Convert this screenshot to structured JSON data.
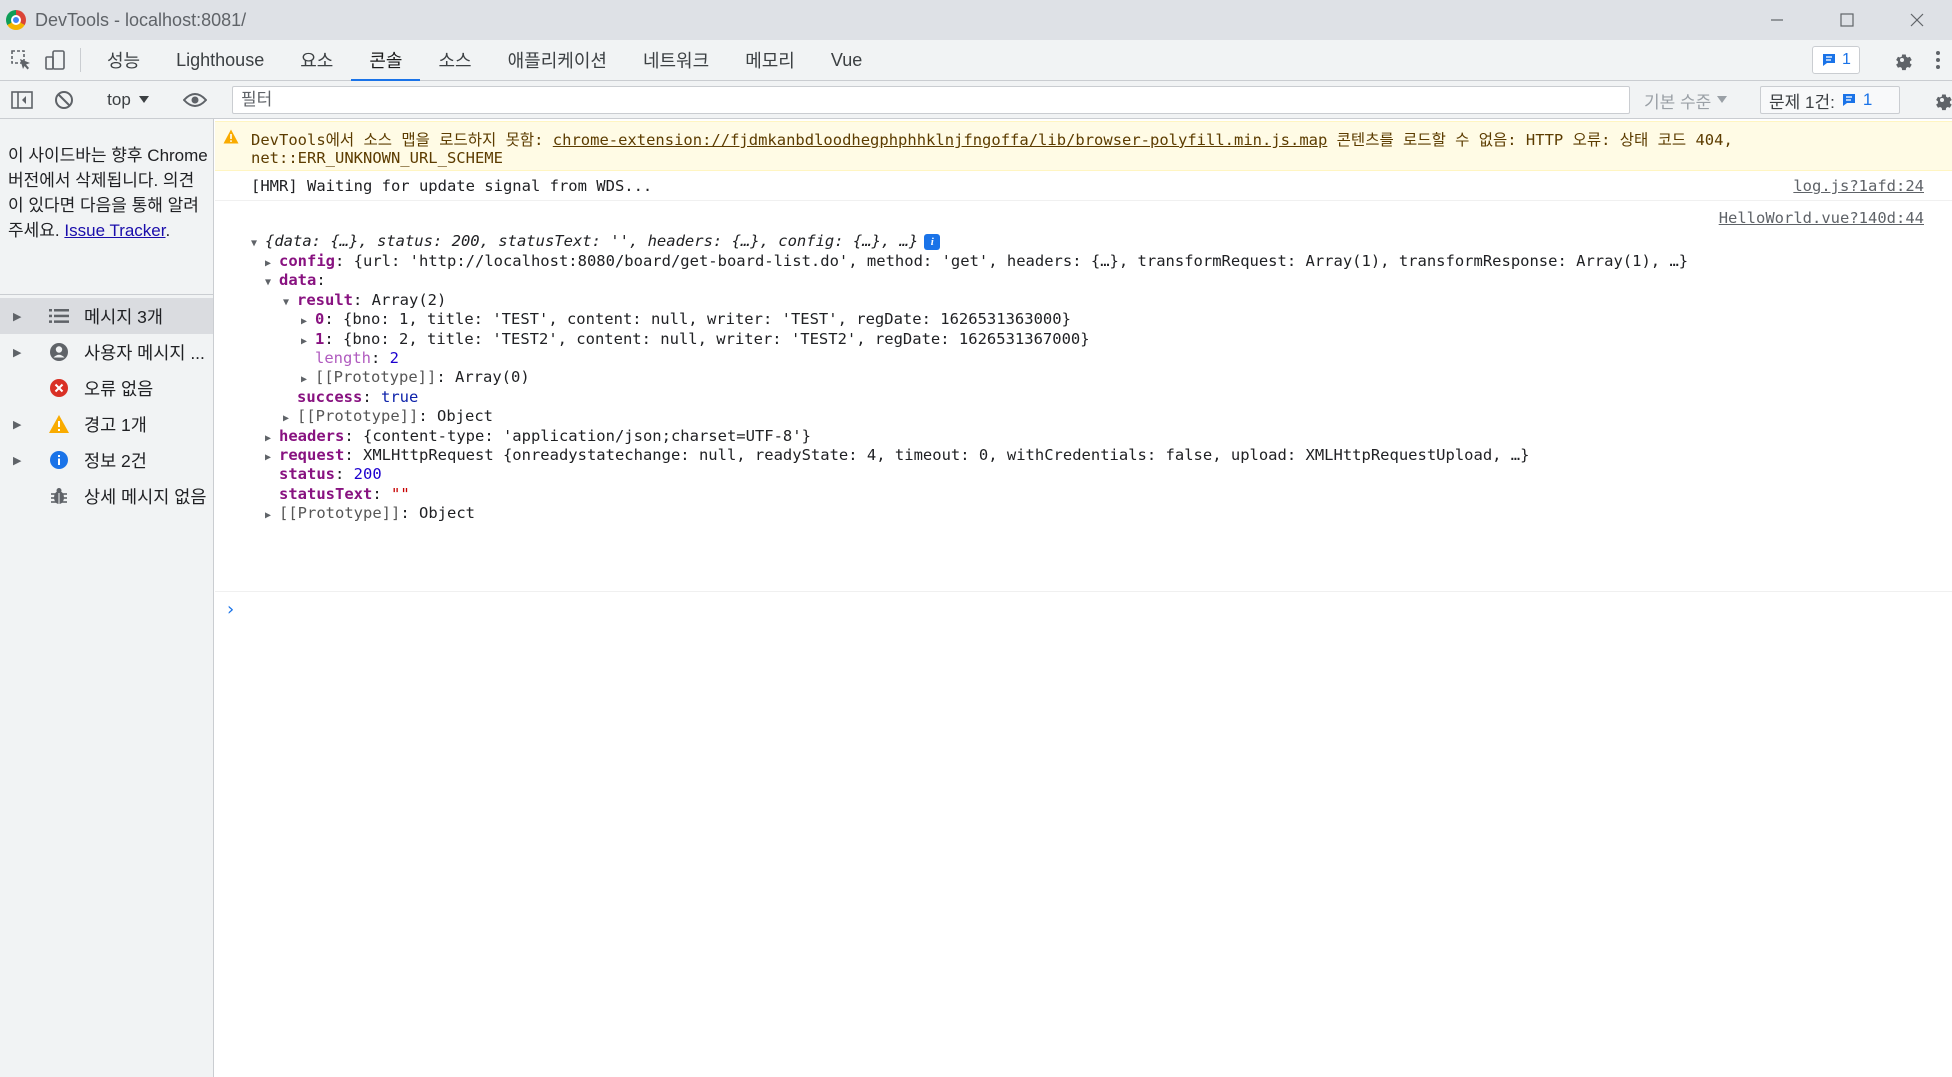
{
  "window": {
    "title": "DevTools - localhost:8081/",
    "minimize": "—",
    "maximize": "☐",
    "close": "✕"
  },
  "tabs": [
    {
      "label": "성능"
    },
    {
      "label": "Lighthouse"
    },
    {
      "label": "요소"
    },
    {
      "label": "콘솔"
    },
    {
      "label": "소스"
    },
    {
      "label": "애플리케이션"
    },
    {
      "label": "네트워크"
    },
    {
      "label": "메모리"
    },
    {
      "label": "Vue"
    }
  ],
  "active_tab": "콘솔",
  "issues_badge": {
    "count": "1"
  },
  "console_toolbar": {
    "context": "top",
    "filter_placeholder": "필터",
    "levels": "기본 수준",
    "issues_label": "문제 1건:",
    "issues_count": "1"
  },
  "sidebar": {
    "note_prefix": "이 사이드바는 향후 Chrome 버전에서 삭제됩니다. 의견이 있다면 다음을 통해 알려 주세요.",
    "note_link": "Issue Tracker",
    "note_suffix": ".",
    "items": [
      {
        "label": "메시지 3개",
        "icon": "list-icon",
        "expandable": true,
        "selected": true
      },
      {
        "label": "사용자 메시지 ...",
        "icon": "user-icon",
        "expandable": true
      },
      {
        "label": "오류 없음",
        "icon": "error-icon",
        "expandable": false
      },
      {
        "label": "경고 1개",
        "icon": "warning-icon",
        "expandable": true
      },
      {
        "label": "정보 2건",
        "icon": "info-icon",
        "expandable": true
      },
      {
        "label": "상세 메시지 없음",
        "icon": "bug-icon",
        "expandable": false
      }
    ]
  },
  "messages": {
    "warning": {
      "prefix": "DevTools에서 소스 맵을 로드하지 못함:",
      "link": "chrome-extension://fjdmkanbdloodhegphphhklnjfngoffa/lib/browser-polyfill.min.js.map",
      "suffix": "콘텐츠를 로드할 수 없음: HTTP 오류: 상태 코드 404,",
      "line2": "net::ERR_UNKNOWN_URL_SCHEME"
    },
    "log": {
      "text": "[HMR] Waiting for update signal from WDS...",
      "source": "log.js?1afd:24"
    },
    "object_source": "HelloWorld.vue?140d:44",
    "object": {
      "summary": "{data: {…}, status: 200, statusText: '', headers: {…}, config: {…}, …}",
      "config_key": "config",
      "config_value": "{url: 'http://localhost:8080/board/get-board-list.do', method: 'get', headers: {…}, transformRequest: Array(1), transformResponse: Array(1), …}",
      "data_key": "data",
      "result_key": "result",
      "result_value": "Array(2)",
      "item0_key": "0",
      "item0_value": "{bno: 1, title: 'TEST', content: null, writer: 'TEST', regDate: 1626531363000}",
      "item1_key": "1",
      "item1_value": "{bno: 2, title: 'TEST2', content: null, writer: 'TEST2', regDate: 1626531367000}",
      "length_key": "length",
      "length_value": "2",
      "proto_key": "[[Prototype]]",
      "proto_array": "Array(0)",
      "success_key": "success",
      "success_value": "true",
      "proto_object": "Object",
      "headers_key": "headers",
      "headers_value": "{content-type: 'application/json;charset=UTF-8'}",
      "request_key": "request",
      "request_value": "XMLHttpRequest {onreadystatechange: null, readyState: 4, timeout: 0, withCredentials: false, upload: XMLHttpRequestUpload, …}",
      "status_key": "status",
      "status_value": "200",
      "statusText_key": "statusText",
      "statusText_value": "\"\""
    }
  },
  "prompt": "›"
}
